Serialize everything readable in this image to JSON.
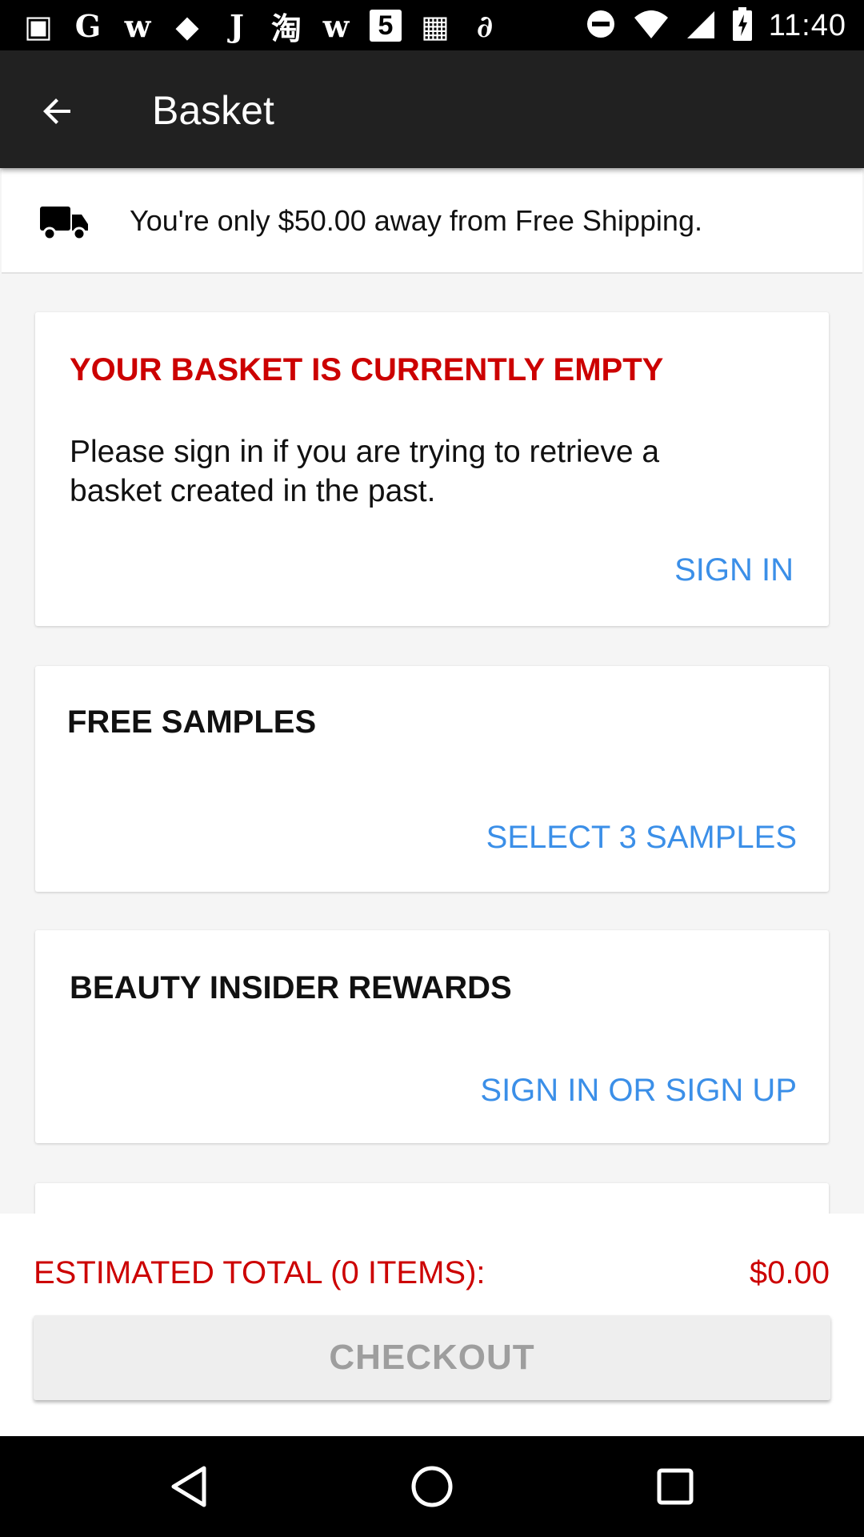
{
  "status_bar": {
    "time": "11:40",
    "notification_icons": [
      {
        "name": "news-icon",
        "glyph": "▣",
        "boxed": false
      },
      {
        "name": "google-icon",
        "glyph": "G",
        "boxed": false
      },
      {
        "name": "w-app-icon",
        "glyph": "w",
        "boxed": false
      },
      {
        "name": "tag-icon",
        "glyph": "◆",
        "boxed": false
      },
      {
        "name": "j-app-icon",
        "glyph": "J",
        "boxed": false
      },
      {
        "name": "taobao-icon",
        "glyph": "淘",
        "boxed": false
      },
      {
        "name": "w-app-icon-2",
        "glyph": "w",
        "boxed": false
      },
      {
        "name": "five-app-icon",
        "glyph": "5",
        "boxed": true
      },
      {
        "name": "grid-app-icon",
        "glyph": "▦",
        "boxed": false
      },
      {
        "name": "link-icon",
        "glyph": "∂",
        "boxed": false
      }
    ]
  },
  "toolbar": {
    "title": "Basket"
  },
  "shipping": {
    "text": "You're only $50.00 away from Free Shipping."
  },
  "empty_card": {
    "heading": "YOUR BASKET IS CURRENTLY EMPTY",
    "message": "Please sign in if you are trying to retrieve a basket created in the past.",
    "action": "SIGN IN"
  },
  "samples_card": {
    "heading": "FREE SAMPLES",
    "action": "SELECT 3 SAMPLES"
  },
  "rewards_card": {
    "heading": "BEAUTY INSIDER REWARDS",
    "action": "SIGN IN OR SIGN UP"
  },
  "checkout": {
    "total_label": "ESTIMATED TOTAL (0 ITEMS):",
    "total_value": "$0.00",
    "button_label": "CHECKOUT"
  },
  "colors": {
    "toolbar_bg": "#212121",
    "accent_red": "#cc0000",
    "link_blue": "#3b8fe8",
    "disabled_text": "#9e9e9e"
  }
}
